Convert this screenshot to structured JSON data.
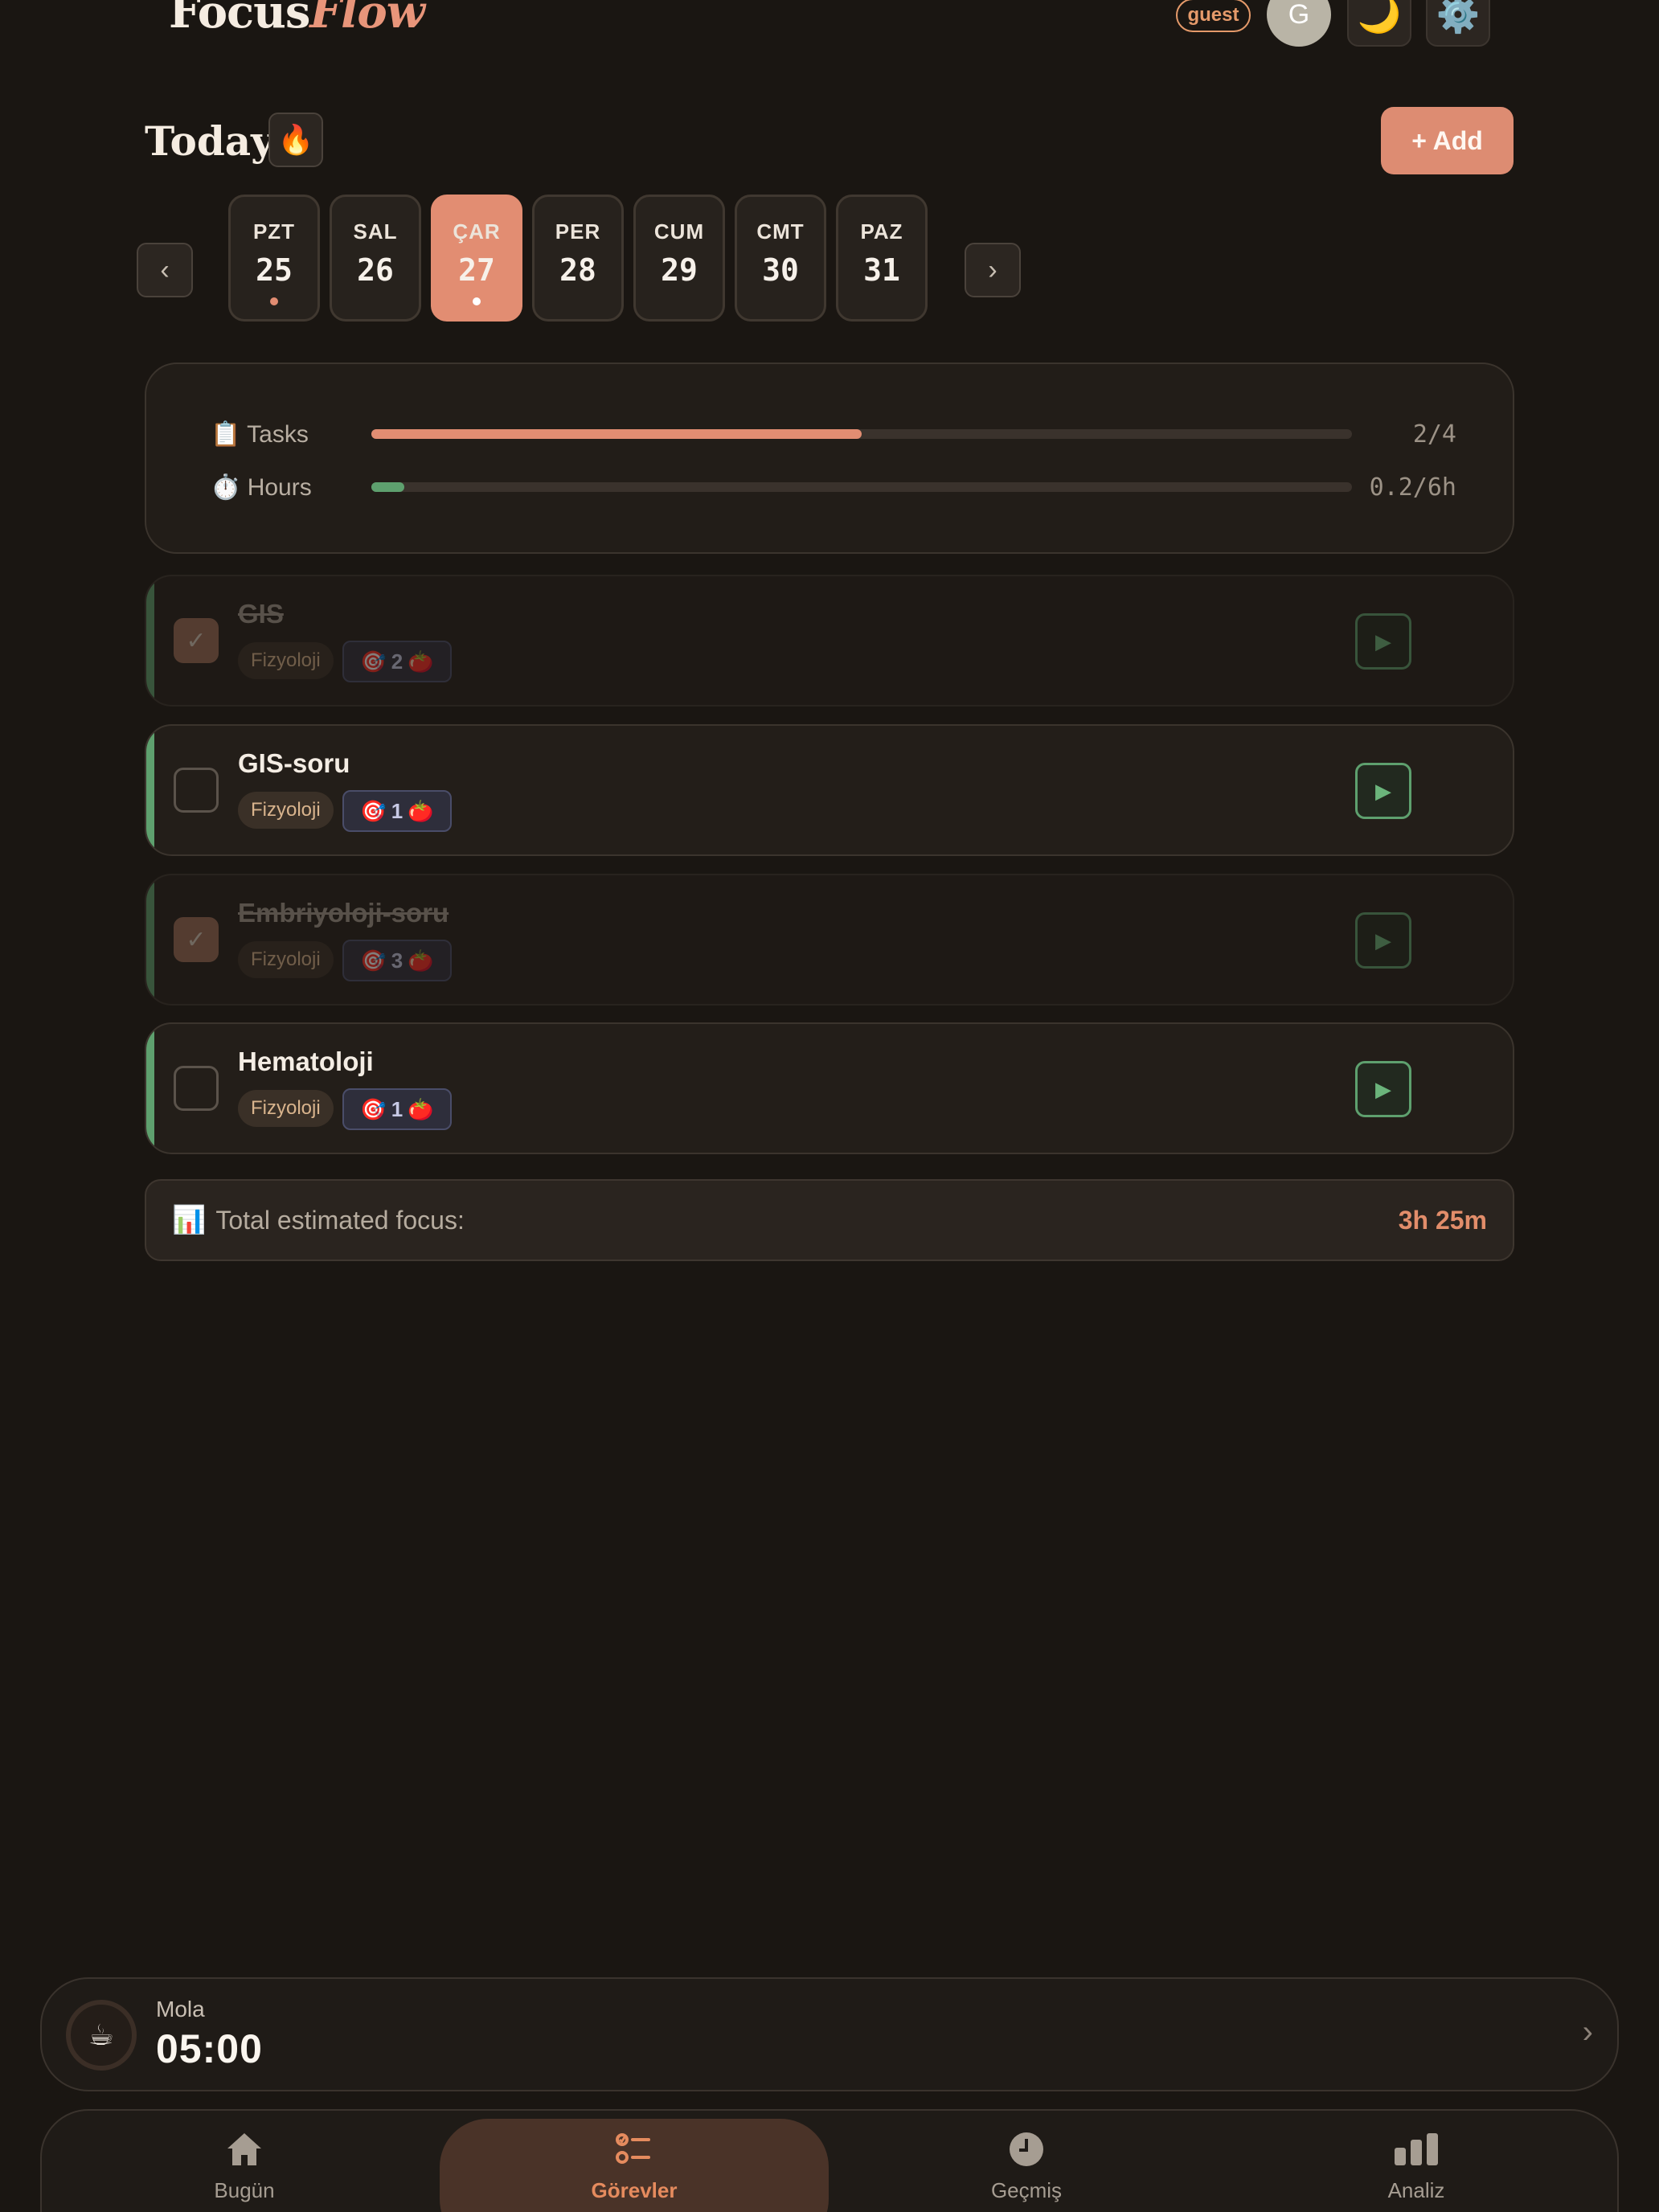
{
  "header": {
    "logo_focus": "Focus",
    "logo_flow": "Flow",
    "guest_badge": "guest",
    "avatar_initial": "G",
    "theme_icon": "🌙",
    "settings_icon": "⚙️"
  },
  "today": {
    "title": "Today",
    "streak_icon": "🔥",
    "add_label": "+ Add"
  },
  "week": {
    "prev": "‹",
    "next": "›",
    "days": [
      {
        "name": "PZT",
        "date": "25",
        "dot": true
      },
      {
        "name": "SAL",
        "date": "26",
        "dot": false
      },
      {
        "name": "ÇAR",
        "date": "27",
        "dot": true,
        "active": true
      },
      {
        "name": "PER",
        "date": "28",
        "dot": false
      },
      {
        "name": "CUM",
        "date": "29",
        "dot": false
      },
      {
        "name": "CMT",
        "date": "30",
        "dot": false
      },
      {
        "name": "PAZ",
        "date": "31",
        "dot": false
      }
    ]
  },
  "progress": {
    "tasks_label": "📋 Tasks",
    "tasks_value": "2/4",
    "tasks_fraction": 0.5,
    "hours_label": "⏱️ Hours",
    "hours_value": "0.2/6h",
    "hours_fraction": 0.0333
  },
  "tasks": [
    {
      "name": "GIS",
      "tag": "Fizyoloji",
      "estimate": "2",
      "done": true
    },
    {
      "name": "GIS-soru",
      "tag": "Fizyoloji",
      "estimate": "1",
      "done": false
    },
    {
      "name": "Embriyoloji-soru",
      "tag": "Fizyoloji",
      "estimate": "3",
      "done": true
    },
    {
      "name": "Hematoloji",
      "tag": "Fizyoloji",
      "estimate": "1",
      "done": false
    }
  ],
  "total": {
    "icon": "📊",
    "label": "Total estimated focus:",
    "value": "3h 25m"
  },
  "timer": {
    "icon": "☕",
    "label": "Mola",
    "value": "05:00"
  },
  "nav": [
    {
      "label": "Bugün",
      "icon": "home-icon"
    },
    {
      "label": "Görevler",
      "icon": "tasks-icon",
      "active": true
    },
    {
      "label": "Geçmiş",
      "icon": "clock-icon"
    },
    {
      "label": "Analiz",
      "icon": "chart-icon"
    }
  ],
  "colors": {
    "accent": "#e28d72",
    "success": "#5ea06e",
    "background": "#1a1612"
  }
}
